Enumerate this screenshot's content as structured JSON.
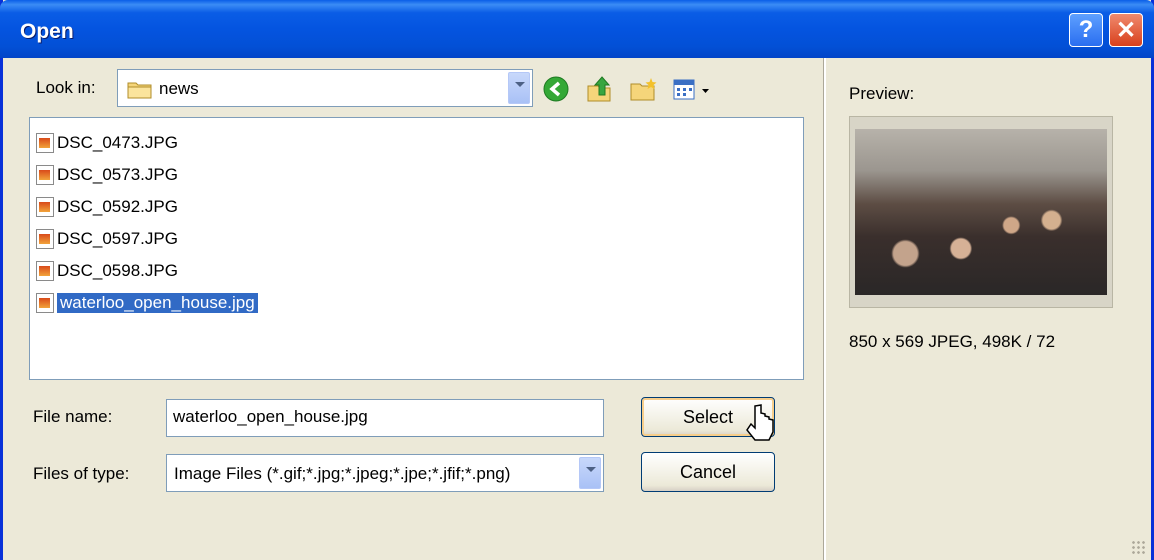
{
  "window": {
    "title": "Open",
    "help_label": "?",
    "close_label": "✕"
  },
  "toolbar": {
    "look_in_label": "Look in:",
    "look_in_value": "news",
    "icons": [
      "back-icon",
      "up-folder-icon",
      "new-folder-icon",
      "views-menu-icon"
    ]
  },
  "files": [
    {
      "name": "DSC_0473.JPG",
      "selected": false
    },
    {
      "name": "DSC_0573.JPG",
      "selected": false
    },
    {
      "name": "DSC_0592.JPG",
      "selected": false
    },
    {
      "name": "DSC_0597.JPG",
      "selected": false
    },
    {
      "name": "DSC_0598.JPG",
      "selected": false
    },
    {
      "name": "waterloo_open_house.jpg",
      "selected": true
    }
  ],
  "form": {
    "file_name_label": "File name:",
    "file_name_value": "waterloo_open_house.jpg",
    "files_of_type_label": "Files of type:",
    "files_of_type_value": "Image Files (*.gif;*.jpg;*.jpeg;*.jpe;*.jfif;*.png)",
    "select_label": "Select",
    "cancel_label": "Cancel"
  },
  "preview": {
    "label": "Preview:",
    "info": "850 x 569 JPEG, 498K / 72"
  },
  "colors": {
    "titlebar": "#0454e0",
    "selection": "#316ac5",
    "dialog_bg": "#ece9d8"
  }
}
